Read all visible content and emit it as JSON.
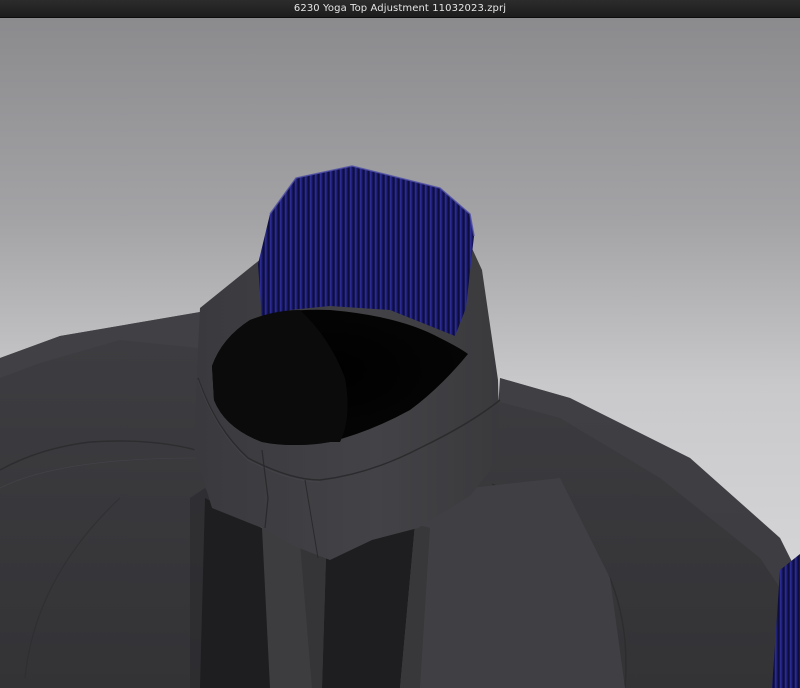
{
  "window": {
    "title": "6230 Yoga Top Adjustment 11032023.zprj"
  },
  "viewport": {
    "background_top": "#8b8b8e",
    "background_bottom": "#dcdcde",
    "garment_color": "#3a3a3d",
    "rib_color": "#1c1c6a"
  }
}
